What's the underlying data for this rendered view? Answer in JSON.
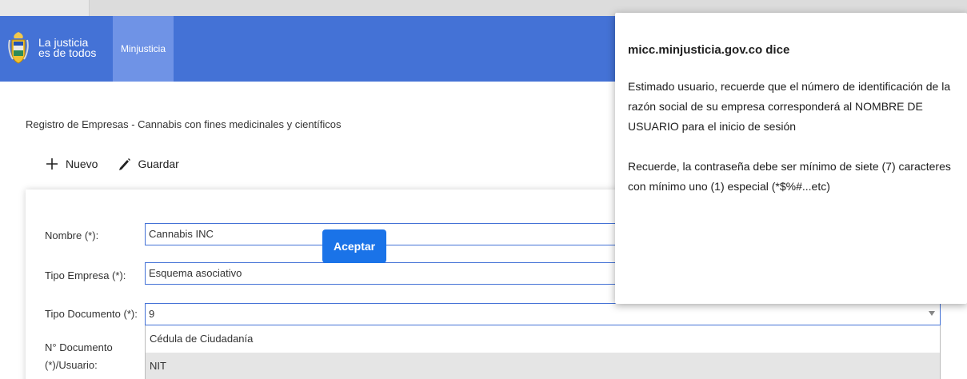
{
  "header": {
    "slogan_line1": "La justicia",
    "slogan_line2": "es de todos",
    "ministry_tab": "Minjusticia",
    "bar_color": "#4472d6"
  },
  "page": {
    "title": "Registro de Empresas - Cannabis con fines medicinales y científicos"
  },
  "toolbar": {
    "new_label": "Nuevo",
    "new_icon": "plus-icon",
    "save_label": "Guardar",
    "save_icon": "pencil-icon"
  },
  "form": {
    "name_label": "Nombre (*):",
    "name_value": "Cannabis INC",
    "company_type_label": "Tipo Empresa (*):",
    "company_type_value": "Esquema asociativo",
    "doc_type_label": "Tipo Documento (*):",
    "doc_type_value": "9",
    "doc_number_label_line1": "N° Documento",
    "doc_number_label_line2": "(*)/Usuario:",
    "doc_type_options": [
      "Cédula de Ciudadanía",
      "NIT"
    ]
  },
  "dialog": {
    "title": "micc.minjusticia.gov.co dice",
    "message_1": "Estimado usuario, recuerde que el número de identificación de la razón social de su empresa corresponderá al NOMBRE DE USUARIO para el inicio de sesión",
    "message_2": "Recuerde, la contraseña debe ser mínimo de siete (7) caracteres con mínimo uno (1) especial (*$%#...etc)",
    "accept_label": "Aceptar",
    "accept_color": "#1a73e8"
  }
}
